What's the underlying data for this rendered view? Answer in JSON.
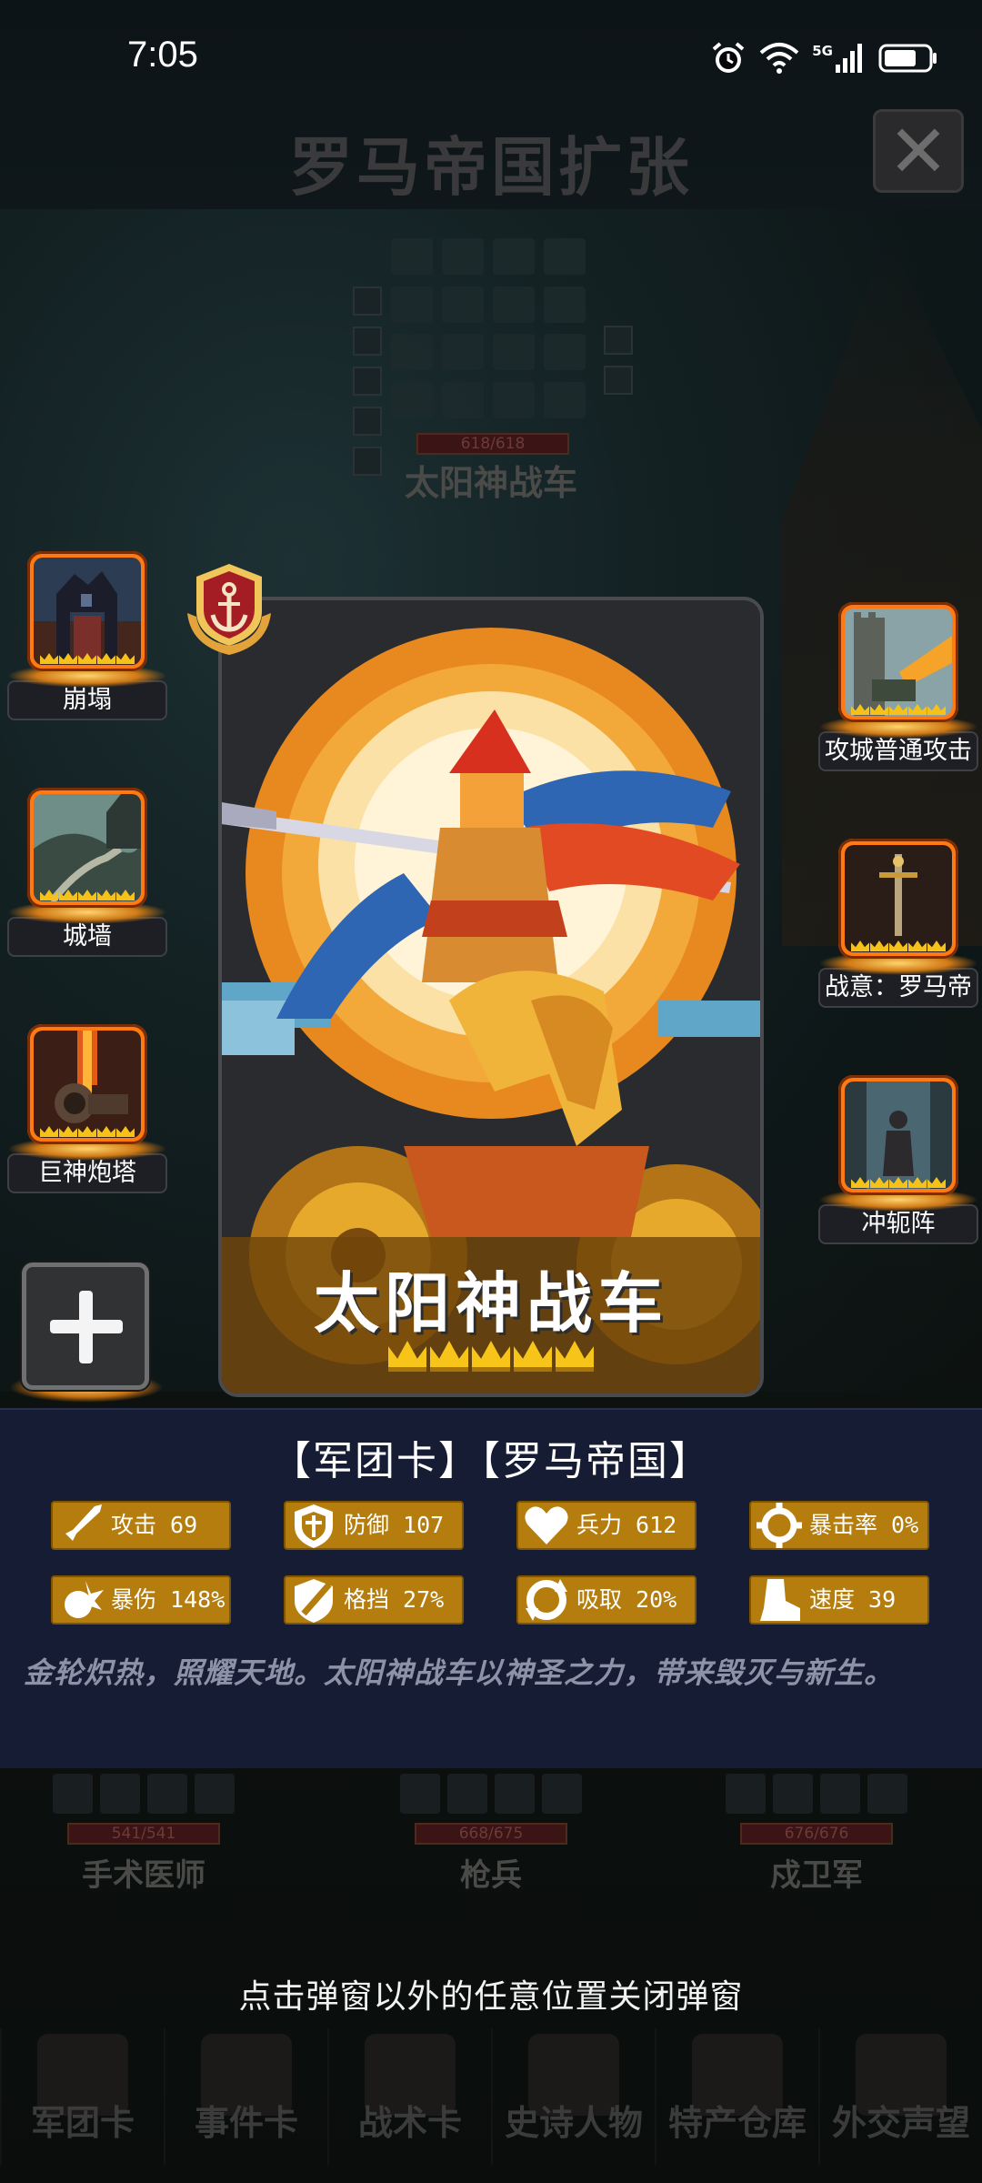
{
  "status_bar": {
    "time": "7:05",
    "network": "5G"
  },
  "background": {
    "title": "罗马帝国扩张",
    "unit_hp": "618/618",
    "unit_name": "太阳神战车",
    "bottom_units": [
      {
        "hp": "541/541",
        "name": "手术医师"
      },
      {
        "hp": "668/675",
        "name": "枪兵"
      },
      {
        "hp": "676/676",
        "name": "戍卫军"
      }
    ],
    "nav": [
      "军团卡",
      "事件卡",
      "战术卡",
      "史诗人物",
      "特产仓库",
      "外交声望"
    ]
  },
  "left_skills": [
    {
      "label": "崩塌",
      "stars": 5
    },
    {
      "label": "城墙",
      "stars": 5
    },
    {
      "label": "巨神炮塔",
      "stars": 5
    }
  ],
  "right_skills": [
    {
      "label": "攻城普通攻击",
      "stars": 5
    },
    {
      "label": "战意：罗马帝",
      "stars": 5
    },
    {
      "label": "冲轭阵",
      "stars": 5
    }
  ],
  "card": {
    "name": "太阳神战车",
    "stars": 5,
    "badge_icon": "anchor-icon"
  },
  "info": {
    "tags": "【军团卡】【罗马帝国】",
    "stats": [
      {
        "icon": "sword-icon",
        "label": "攻击 69"
      },
      {
        "icon": "shield-icon",
        "label": "防御 107"
      },
      {
        "icon": "heart-icon",
        "label": "兵力 612"
      },
      {
        "icon": "crit-target-icon",
        "label": "暴击率 0%"
      },
      {
        "icon": "burst-icon",
        "label": "暴伤 148%"
      },
      {
        "icon": "block-shield-icon",
        "label": "格挡 27%"
      },
      {
        "icon": "lifesteal-icon",
        "label": "吸取 20%"
      },
      {
        "icon": "speed-boot-icon",
        "label": "速度 39"
      }
    ],
    "description": "金轮炽热，照耀天地。太阳神战车以神圣之力，带来毁灭与新生。"
  },
  "hint": "点击弹窗以外的任意位置关闭弹窗",
  "colors": {
    "skill_frame": "#ff7a12",
    "stat_bg": "#b57d0d",
    "panel_bg": "#161c33",
    "star_gold": "#f7c51a"
  }
}
